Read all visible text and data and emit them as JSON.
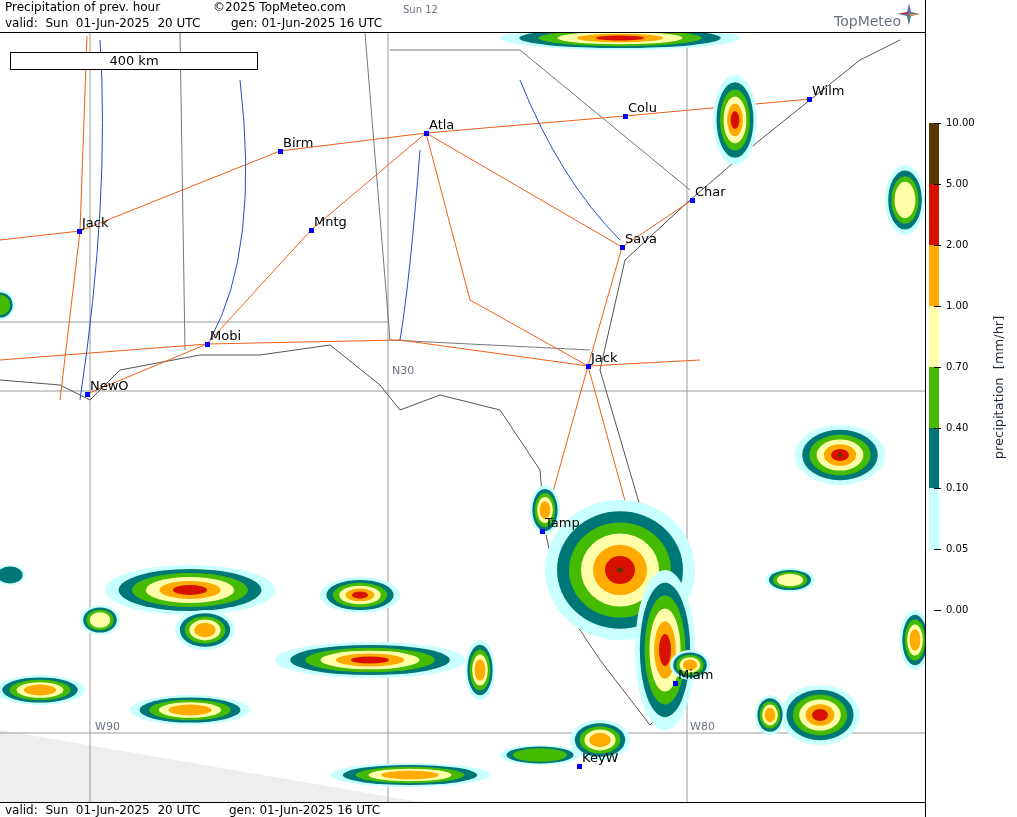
{
  "header": {
    "title": "Precipitation of prev. hour",
    "copyright": "©2025 TopMeteo.com",
    "run": "Sun 12",
    "valid": "valid:  Sun  01-Jun-2025  20 UTC",
    "gen": "gen: 01-Jun-2025 16 UTC",
    "logo": "TopMeteo"
  },
  "map": {
    "scale_label": "400 km",
    "cities": [
      {
        "name": "Wilm"
      },
      {
        "name": "Colu"
      },
      {
        "name": "Atla"
      },
      {
        "name": "Birm"
      },
      {
        "name": "Char"
      },
      {
        "name": "Jack"
      },
      {
        "name": "Mntg"
      },
      {
        "name": "Sava"
      },
      {
        "name": "Mobi"
      },
      {
        "name": "Jack"
      },
      {
        "name": "NewO"
      },
      {
        "name": "Tamp"
      },
      {
        "name": "Miam"
      },
      {
        "name": "KeyW"
      }
    ],
    "grid_labels": [
      "N30",
      "W90",
      "W80"
    ]
  },
  "legend": {
    "axis_label": "precipitation  [mm/hr]",
    "ticks": [
      "10.00",
      "5.00",
      "2.00",
      "1.00",
      "0.70",
      "0.40",
      "0.10",
      "0.05",
      "0.00"
    ],
    "bands": [
      {
        "color": "#583a00"
      },
      {
        "color": "#d81000"
      },
      {
        "color": "#ffaa00"
      },
      {
        "color": "#ffffaa"
      },
      {
        "color": "#44bb00"
      },
      {
        "color": "#007777"
      },
      {
        "color": "#c8ffff"
      }
    ]
  },
  "footer": {
    "valid": "valid:  Sun  01-Jun-2025  20 UTC",
    "gen": "gen: 01-Jun-2025 16 UTC"
  }
}
